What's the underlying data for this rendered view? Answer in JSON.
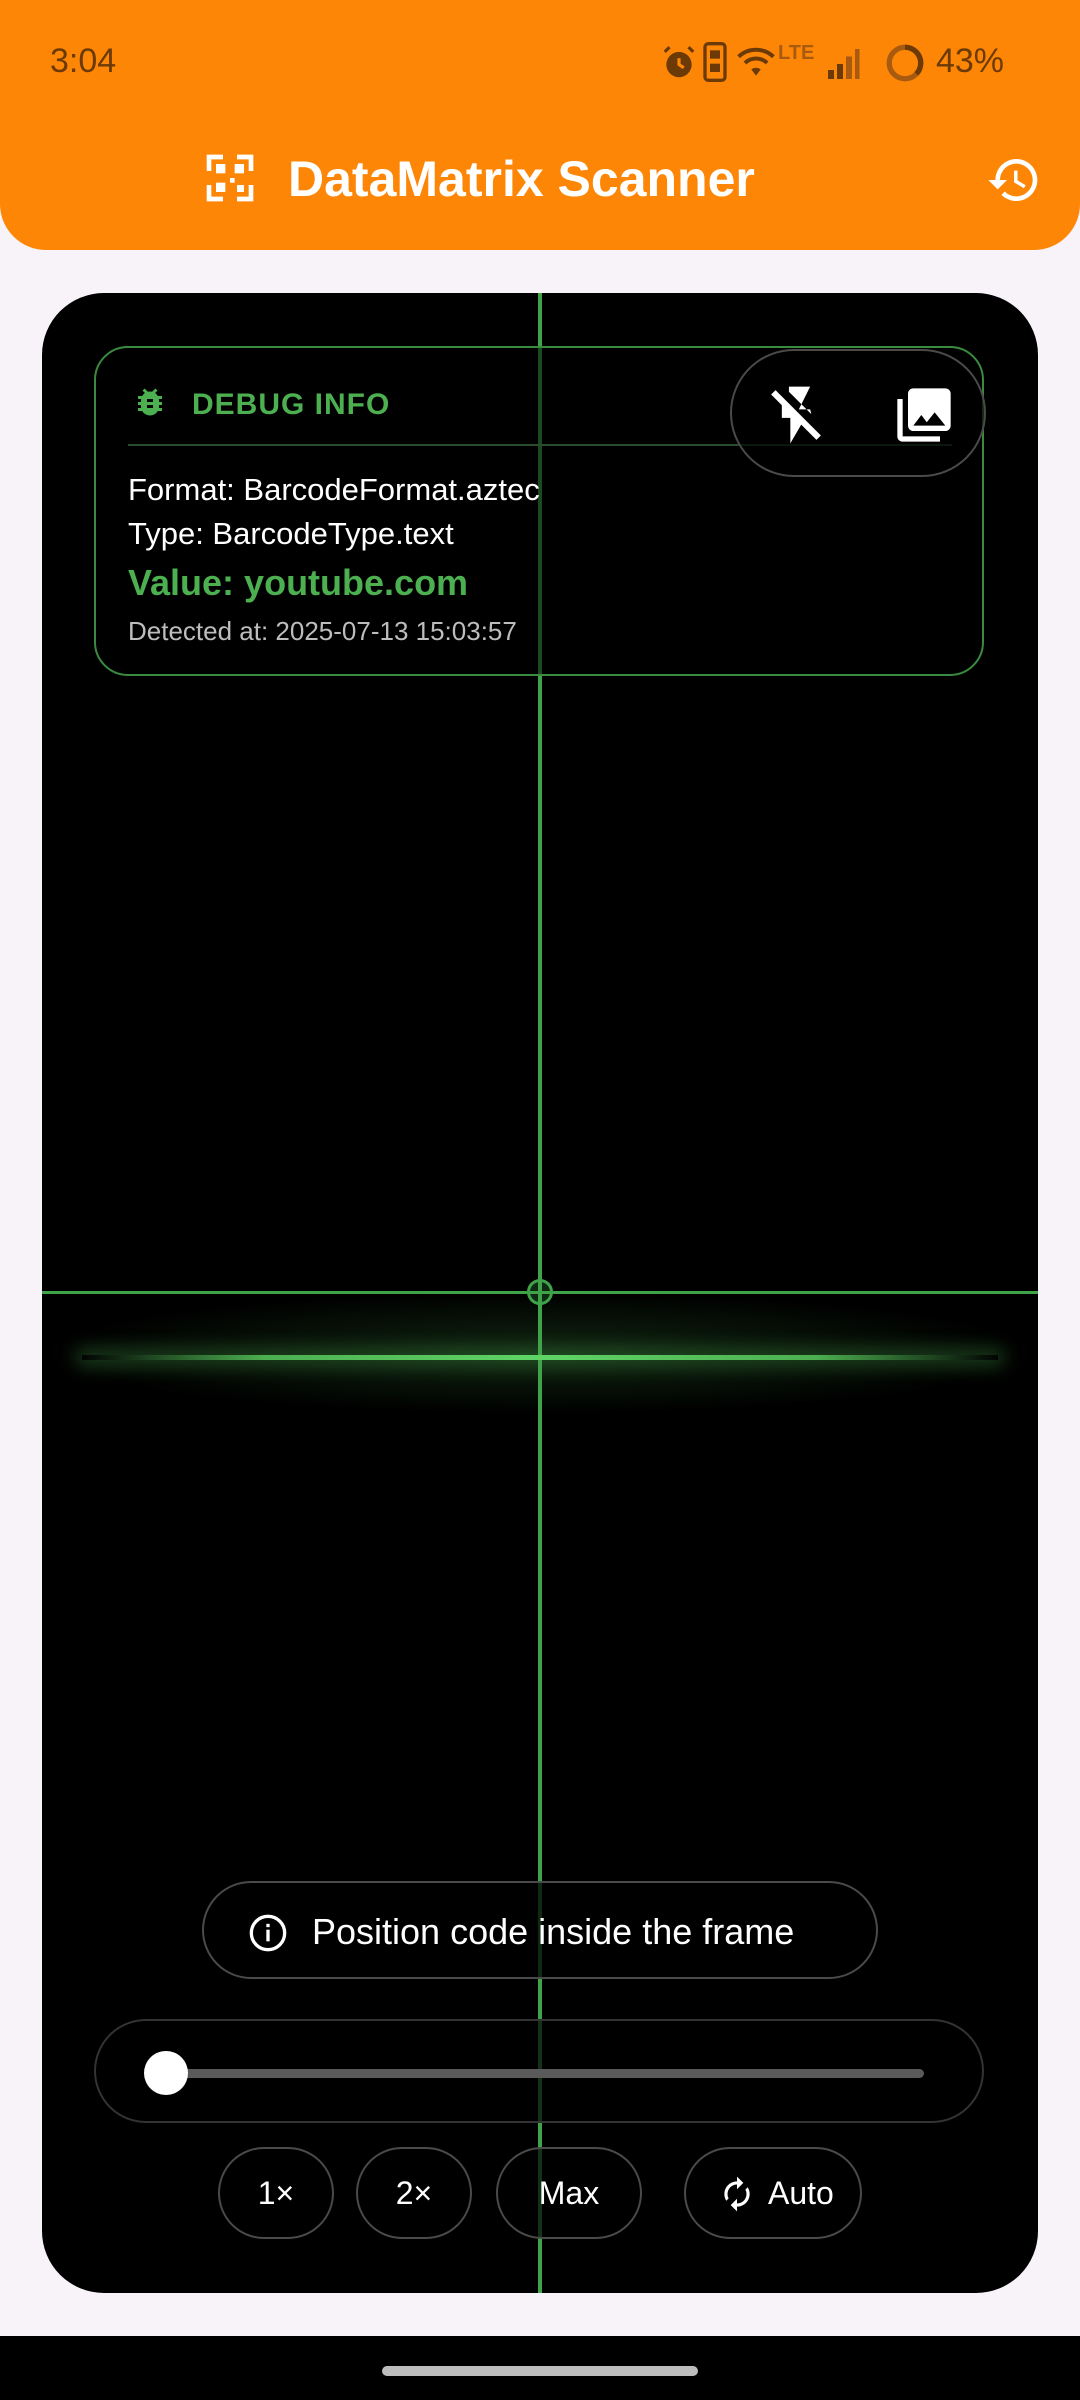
{
  "status_bar": {
    "time": "3:04",
    "network": "LTE",
    "battery": "43%"
  },
  "app_bar": {
    "title": "DataMatrix Scanner",
    "color": "#fe8606"
  },
  "scanner": {
    "accent_color": "#4caf50",
    "debug": {
      "title": "DEBUG INFO",
      "format": "Format: BarcodeFormat.aztec",
      "type": "Type: BarcodeType.text",
      "value": "Value: youtube.com",
      "detected_at": "Detected at: 2025-07-13 15:03:57"
    },
    "hint": "Position  code inside the frame",
    "zoom": {
      "level": 0,
      "buttons": {
        "x1": "1×",
        "x2": "2×",
        "max": "Max",
        "auto": "Auto"
      }
    }
  }
}
